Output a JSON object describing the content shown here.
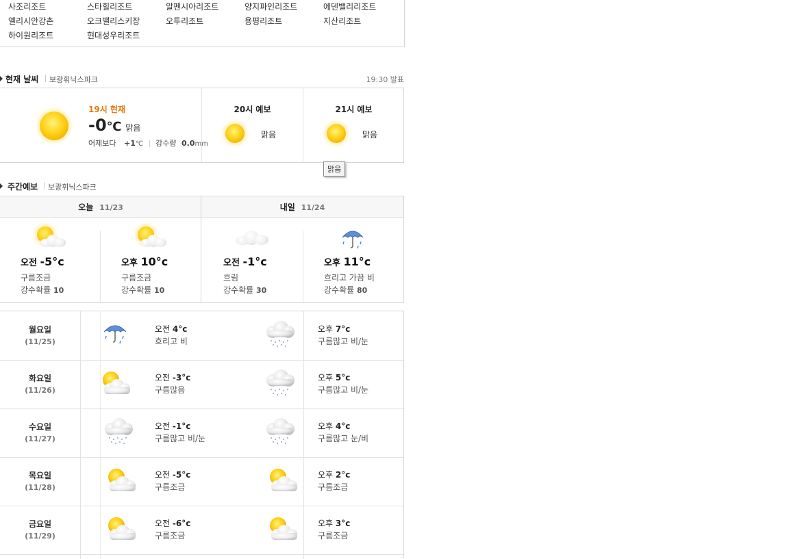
{
  "resorts": [
    [
      "사조리조트",
      "스타힐리조트",
      "알펜시아리조트",
      "양지파인리조트",
      "에덴밸리리조트"
    ],
    [
      "엘리시안강촌",
      "오크밸리스키장",
      "오투리조트",
      "용평리조트",
      "지산리조트"
    ],
    [
      "하이원리조트",
      "현대성우리조트"
    ]
  ],
  "current": {
    "title": "현재 날씨",
    "location": "보광휘닉스파크",
    "published": "19:30 발표",
    "now_label": "19시 현재",
    "temp": "-0",
    "temp_unit": "℃",
    "condition": "맑음",
    "vs_yesterday_label": "어제보다",
    "vs_yesterday_value": "+1",
    "vs_yesterday_unit": "℃",
    "precip_label": "강수량",
    "precip_value": "0.0",
    "precip_unit": "mm",
    "forecasts": [
      {
        "label": "20시 예보",
        "condition": "맑음"
      },
      {
        "label": "21시 예보",
        "condition": "맑음"
      }
    ],
    "tooltip": "맑음"
  },
  "weekly": {
    "title": "주간예보",
    "location": "보광휘닉스파크",
    "days": [
      {
        "label": "오늘",
        "date": "11/23"
      },
      {
        "label": "내일",
        "date": "11/24"
      }
    ],
    "cells": [
      {
        "period": "오전",
        "temp": "-5",
        "unit": "°c",
        "condition": "구름조금",
        "pop_label": "강수확률",
        "pop": "10",
        "icon": "partly-cloudy-icon"
      },
      {
        "period": "오후",
        "temp": "10",
        "unit": "°c",
        "condition": "구름조금",
        "pop_label": "강수확률",
        "pop": "10",
        "icon": "partly-cloudy-icon"
      },
      {
        "period": "오전",
        "temp": "-1",
        "unit": "°c",
        "condition": "흐림",
        "pop_label": "강수확률",
        "pop": "30",
        "icon": "cloudy-icon"
      },
      {
        "period": "오후",
        "temp": "11",
        "unit": "°c",
        "condition": "흐리고 가끔 비",
        "pop_label": "강수확률",
        "pop": "80",
        "icon": "umbrella-icon"
      }
    ]
  },
  "daily": [
    {
      "day": "월요일",
      "date": "(11/25)",
      "am_label": "오전",
      "am_temp": "4",
      "am_cond": "흐리고 비",
      "am_icon": "umbrella-icon",
      "pm_label": "오후",
      "pm_temp": "7",
      "pm_cond": "구름많고 비/눈",
      "pm_icon": "rain-snow-icon",
      "unit": "°c"
    },
    {
      "day": "화요일",
      "date": "(11/26)",
      "am_label": "오전",
      "am_temp": "-3",
      "am_cond": "구름많음",
      "am_icon": "partly-cloudy-icon",
      "pm_label": "오후",
      "pm_temp": "5",
      "pm_cond": "구름많고 비/눈",
      "pm_icon": "rain-snow-icon",
      "unit": "°c"
    },
    {
      "day": "수요일",
      "date": "(11/27)",
      "am_label": "오전",
      "am_temp": "-1",
      "am_cond": "구름많고 비/눈",
      "am_icon": "rain-snow-icon",
      "pm_label": "오후",
      "pm_temp": "4",
      "pm_cond": "구름많고 눈/비",
      "pm_icon": "rain-snow-icon",
      "unit": "°c"
    },
    {
      "day": "목요일",
      "date": "(11/28)",
      "am_label": "오전",
      "am_temp": "-5",
      "am_cond": "구름조금",
      "am_icon": "partly-cloudy-icon",
      "pm_label": "오후",
      "pm_temp": "2",
      "pm_cond": "구름조금",
      "pm_icon": "partly-cloudy-icon",
      "unit": "°c"
    },
    {
      "day": "금요일",
      "date": "(11/29)",
      "am_label": "오전",
      "am_temp": "-6",
      "am_cond": "구름조금",
      "am_icon": "partly-cloudy-icon",
      "pm_label": "오후",
      "pm_temp": "3",
      "pm_cond": "구름조금",
      "pm_icon": "partly-cloudy-icon",
      "unit": "°c"
    }
  ],
  "colors": {
    "accent_orange": "#e8760a",
    "border": "#d5d5d5"
  }
}
